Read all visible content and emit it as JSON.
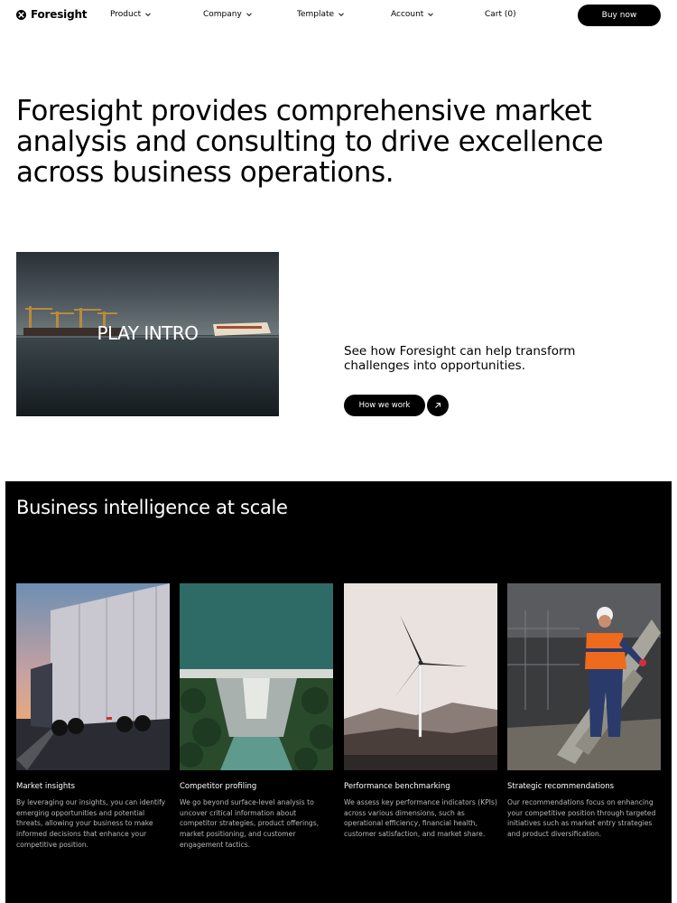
{
  "nav": {
    "brand": "Foresight",
    "items": [
      {
        "label": "Product"
      },
      {
        "label": "Company"
      },
      {
        "label": "Template"
      },
      {
        "label": "Account"
      }
    ],
    "cart": "Cart (0)",
    "buy_label": "Buy now"
  },
  "hero": {
    "title": "Foresight provides comprehensive market analysis and consulting to drive excellence across business operations."
  },
  "intro": {
    "play_label": "PLAY INTRO",
    "text": "See how Foresight can help transform challenges into opportunities.",
    "button_label": "How we work"
  },
  "section": {
    "title": "Business intelligence at scale",
    "cards": [
      {
        "title": "Market insights",
        "description": "By leveraging our insights, you can identify emerging opportunities and potential threats, allowing your business to make informed decisions that enhance your competitive position."
      },
      {
        "title": "Competitor profiling",
        "description": "We go beyond surface-level analysis to uncover critical information about competitor strategies, product offerings, market positioning, and customer engagement tactics."
      },
      {
        "title": "Performance benchmarking",
        "description": "We assess key performance indicators (KPIs) across various dimensions, such as operational efficiency, financial health, customer satisfaction, and market share."
      },
      {
        "title": "Strategic recommendations",
        "description": "Our recommendations focus on enhancing your competitive position through targeted initiatives such as market entry strategies and product diversification."
      }
    ]
  },
  "colors": {
    "primary": "#000000",
    "background": "#ffffff",
    "muted_text": "#b8b8b8"
  },
  "icons": [
    "logo-icon",
    "chevron-down-icon",
    "arrow-up-right-icon"
  ]
}
